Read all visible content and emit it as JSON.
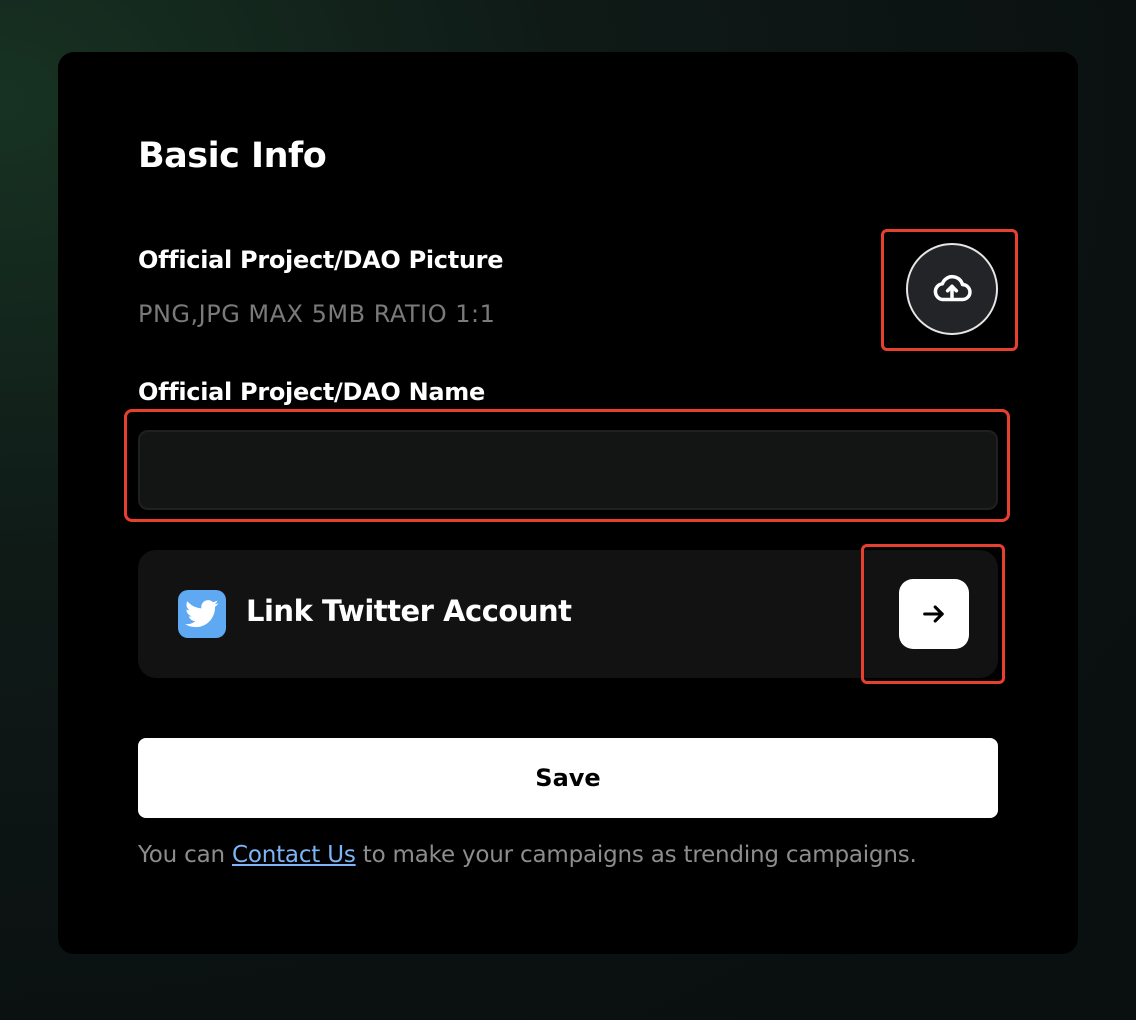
{
  "basic_info": {
    "title": "Basic Info",
    "picture": {
      "label": "Official Project/DAO Picture",
      "hint": "PNG,JPG MAX 5MB RATIO 1:1",
      "upload_icon": "cloud-upload-icon"
    },
    "name": {
      "label": "Official Project/DAO Name",
      "value": "",
      "placeholder": ""
    },
    "twitter": {
      "icon": "twitter-bird-icon",
      "label": "Link Twitter Account",
      "action_icon": "arrow-right-icon"
    },
    "save_label": "Save",
    "footer": {
      "prefix": "You can",
      "link_text": "Contact Us",
      "suffix": "to make your campaigns as trending campaigns."
    }
  },
  "colors": {
    "highlight": "#e8402e",
    "link": "#7db3f7",
    "twitter": "#5fa8f2",
    "muted_text": "#7a7a7a"
  }
}
